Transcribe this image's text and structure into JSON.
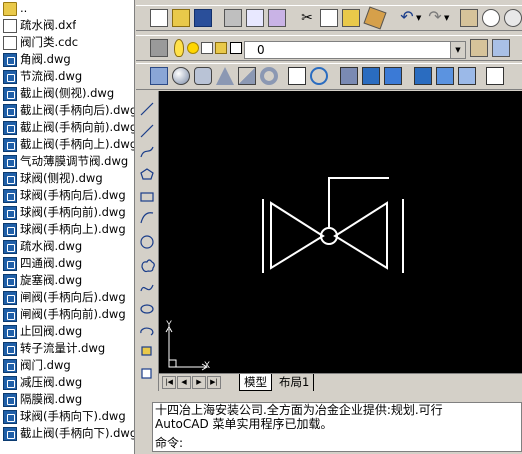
{
  "files": [
    {
      "name": "..",
      "type": "folder"
    },
    {
      "name": "疏水阀.dxf",
      "type": "dxf"
    },
    {
      "name": "阀门类.cdc",
      "type": "cdc"
    },
    {
      "name": "角阀.dwg",
      "type": "dwg"
    },
    {
      "name": "节流阀.dwg",
      "type": "dwg"
    },
    {
      "name": "截止阀(侧视).dwg",
      "type": "dwg"
    },
    {
      "name": "截止阀(手柄向后).dwg",
      "type": "dwg"
    },
    {
      "name": "截止阀(手柄向前).dwg",
      "type": "dwg"
    },
    {
      "name": "截止阀(手柄向上).dwg",
      "type": "dwg"
    },
    {
      "name": "气动薄膜调节阀.dwg",
      "type": "dwg"
    },
    {
      "name": "球阀(侧视).dwg",
      "type": "dwg"
    },
    {
      "name": "球阀(手柄向后).dwg",
      "type": "dwg"
    },
    {
      "name": "球阀(手柄向前).dwg",
      "type": "dwg"
    },
    {
      "name": "球阀(手柄向上).dwg",
      "type": "dwg"
    },
    {
      "name": "疏水阀.dwg",
      "type": "dwg"
    },
    {
      "name": "四通阀.dwg",
      "type": "dwg"
    },
    {
      "name": "旋塞阀.dwg",
      "type": "dwg"
    },
    {
      "name": "闸阀(手柄向后).dwg",
      "type": "dwg"
    },
    {
      "name": "闸阀(手柄向前).dwg",
      "type": "dwg"
    },
    {
      "name": "止回阀.dwg",
      "type": "dwg"
    },
    {
      "name": "转子流量计.dwg",
      "type": "dwg"
    },
    {
      "name": "阀门.dwg",
      "type": "dwg"
    },
    {
      "name": "减压阀.dwg",
      "type": "dwg"
    },
    {
      "name": "隔膜阀.dwg",
      "type": "dwg"
    },
    {
      "name": "球阀(手柄向下).dwg",
      "type": "dwg"
    },
    {
      "name": "截止阀(手柄向下).dwg",
      "type": "dwg"
    }
  ],
  "layer": {
    "current": "0"
  },
  "tabs": {
    "model": "模型",
    "layout1": "布局1"
  },
  "ucs": {
    "x": "X",
    "y": "Y"
  },
  "command": {
    "line1": "十四冶上海安装公司.全方面为冶金企业提供:规划.可行",
    "line2": "AutoCAD 菜单实用程序已加载。",
    "prompt": "命令:"
  },
  "colors": {
    "canvas": "#000000",
    "drawing": "#ffffff",
    "chrome": "#d4d0c8"
  }
}
